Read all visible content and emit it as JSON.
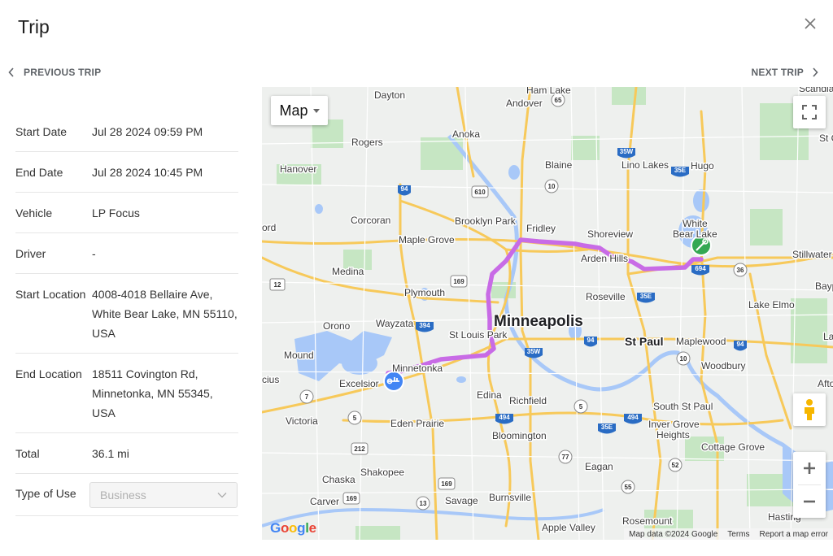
{
  "header": {
    "title": "Trip"
  },
  "nav": {
    "previous_label": "PREVIOUS TRIP",
    "next_label": "NEXT TRIP"
  },
  "details": [
    {
      "label": "Start Date",
      "value": "Jul 28 2024 09:59 PM"
    },
    {
      "label": "End Date",
      "value": "Jul 28 2024 10:45 PM"
    },
    {
      "label": "Vehicle",
      "value": "LP Focus"
    },
    {
      "label": "Driver",
      "value": "-"
    },
    {
      "label": "Start Location",
      "value": "4008-4018 Bellaire Ave, White Bear Lake, MN 55110, USA"
    },
    {
      "label": "End Location",
      "value": "18511 Covington Rd, Minnetonka, MN 55345, USA"
    },
    {
      "label": "Total",
      "value": "36.1 mi"
    }
  ],
  "type_of_use": {
    "label": "Type of Use",
    "value": "Business"
  },
  "map": {
    "map_type_label": "Map",
    "attribution": {
      "data": "Map data ©2024 Google",
      "terms": "Terms",
      "report": "Report a map error"
    },
    "logo_text": "Google",
    "route_color": "#c86be6",
    "start_marker_color": "#34a853",
    "end_marker_color": "#4285f4",
    "places": {
      "minneapolis": "Minneapolis",
      "st_paul": "St Paul",
      "dayton": "Dayton",
      "ham_lake": "Ham Lake",
      "andover": "Andover",
      "anoka": "Anoka",
      "rogers": "Rogers",
      "hanover": "Hanover",
      "blaine": "Blaine",
      "lino_lakes": "Lino Lakes",
      "hugo": "Hugo",
      "corcoran": "Corcoran",
      "brooklyn_park": "Brooklyn Park",
      "fridley": "Fridley",
      "shoreview": "Shoreview",
      "white_bear_lake": "White\nBear Lake",
      "white": "White",
      "bear_lake": "Bear Lake",
      "maple_grove": "Maple Grove",
      "arden_hills": "Arden Hills",
      "medina": "Medina",
      "plymouth": "Plymouth",
      "roseville": "Roseville",
      "stillwater": "Stillwater",
      "ord": "ord",
      "orono": "Orono",
      "wayzata": "Wayzata",
      "st_louis_park": "St Louis Park",
      "lake_elmo": "Lake Elmo",
      "mound": "Mound",
      "minnetonka": "Minnetonka",
      "maplewood": "Maplewood",
      "woodbury": "Woodbury",
      "excelsior": "Excelsior",
      "edina": "Edina",
      "richfield": "Richfield",
      "south_st_paul": "South St Paul",
      "victoria": "Victoria",
      "eden_prairie": "Eden Prairie",
      "inver_grove_heights": "Inver Grove\nHeights",
      "inver_grove": "Inver Grove",
      "heights": "Heights",
      "bloomington": "Bloomington",
      "cottage_grove": "Cottage Grove",
      "eagan": "Eagan",
      "chaska": "Chaska",
      "shakopee": "Shakopee",
      "burnsville": "Burnsville",
      "carver": "Carver",
      "savage": "Savage",
      "rosemount": "Rosemount",
      "hastings": "Hasting",
      "apple_valley": "Apple Valley",
      "scandia": "Scandia",
      "st_c": "St C",
      "bayp": "Bayp",
      "la": "La",
      "afto": "Afto",
      "cius": "cius"
    },
    "shields": [
      "65",
      "35W",
      "35E",
      "10",
      "610",
      "94",
      "12",
      "169",
      "394",
      "35W",
      "94",
      "35E",
      "694",
      "36",
      "94",
      "10",
      "7",
      "5",
      "494",
      "5",
      "494",
      "35E",
      "212",
      "77",
      "52",
      "169",
      "169",
      "13",
      "55"
    ]
  }
}
